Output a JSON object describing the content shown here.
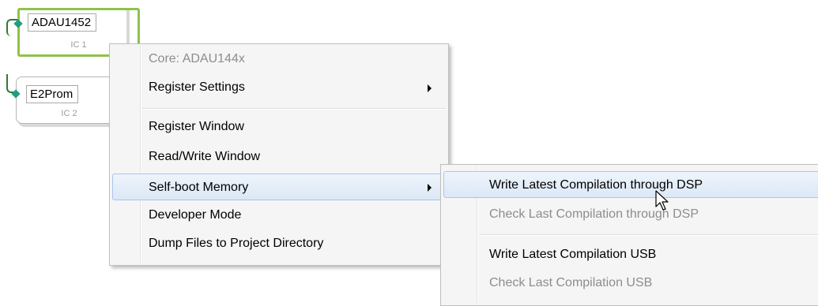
{
  "ic1": {
    "name": "ADAU1452",
    "label": "IC 1"
  },
  "ic2": {
    "name": "E2Prom",
    "label": "IC 2"
  },
  "context_menu": {
    "items": [
      {
        "label": "Core: ADAU144x",
        "disabled": true
      },
      {
        "label": "Register Settings",
        "submenu": true
      },
      {
        "label": "Register Window"
      },
      {
        "label": "Read/Write Window"
      },
      {
        "label": "Self-boot Memory",
        "submenu": true,
        "highlighted": true
      },
      {
        "label": "Developer Mode"
      },
      {
        "label": "Dump Files to Project Directory"
      }
    ]
  },
  "submenu": {
    "items": [
      {
        "label": "Write Latest Compilation through DSP",
        "highlighted": true
      },
      {
        "label": "Check Last Compilation through DSP",
        "disabled": true
      },
      {
        "label": "Write Latest Compilation USB"
      },
      {
        "label": "Check Last Compilation USB",
        "disabled": true
      }
    ]
  },
  "colors": {
    "selected_border": "#8fc24a",
    "pin": "#1f9e80",
    "wire": "#2e7d32",
    "menu_highlight": "#dbe8f6"
  }
}
